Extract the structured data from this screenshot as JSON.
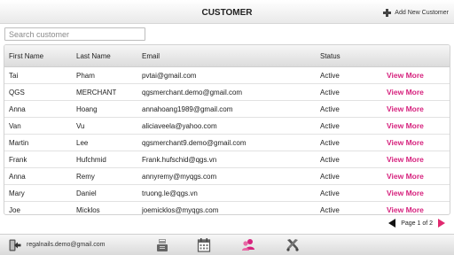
{
  "header": {
    "title": "CUSTOMER",
    "add_label": "Add New Customer"
  },
  "search": {
    "placeholder": "Search customer",
    "value": ""
  },
  "table": {
    "columns": [
      "First Name",
      "Last Name",
      "Email",
      "Status",
      ""
    ],
    "rows": [
      {
        "first": "Tai",
        "last": "Pham",
        "email": "pvtai@gmail.com",
        "status": "Active",
        "action": "View More"
      },
      {
        "first": "QGS",
        "last": "MERCHANT",
        "email": "qgsmerchant.demo@gmail.com",
        "status": "Active",
        "action": "View More"
      },
      {
        "first": "Anna",
        "last": "Hoang",
        "email": "annahoang1989@gmail.com",
        "status": "Active",
        "action": "View More"
      },
      {
        "first": "Van",
        "last": "Vu",
        "email": "aliciaveela@yahoo.com",
        "status": "Active",
        "action": "View More"
      },
      {
        "first": "Martin",
        "last": "Lee",
        "email": "qgsmerchant9.demo@gmail.com",
        "status": "Active",
        "action": "View More"
      },
      {
        "first": "Frank",
        "last": "Hufchmid",
        "email": "Frank.hufschid@qgs.vn",
        "status": "Active",
        "action": "View More"
      },
      {
        "first": "Anna",
        "last": "Remy",
        "email": "annyremy@myqgs.com",
        "status": "Active",
        "action": "View More"
      },
      {
        "first": "Mary",
        "last": "Daniel",
        "email": "truong.le@qgs.vn",
        "status": "Active",
        "action": "View More"
      },
      {
        "first": "Joe",
        "last": "Micklos",
        "email": "joemicklos@myqgs.com",
        "status": "Active",
        "action": "View More"
      }
    ]
  },
  "pager": {
    "label": "Page 1 of 2"
  },
  "footer": {
    "user_email": "regalnails.demo@gmail.com",
    "icons": [
      "logout-icon",
      "register-icon",
      "calendar-icon",
      "customers-icon",
      "settings-icon"
    ]
  },
  "colors": {
    "accent": "#d6237e",
    "next_arrow": "#e0296f"
  }
}
